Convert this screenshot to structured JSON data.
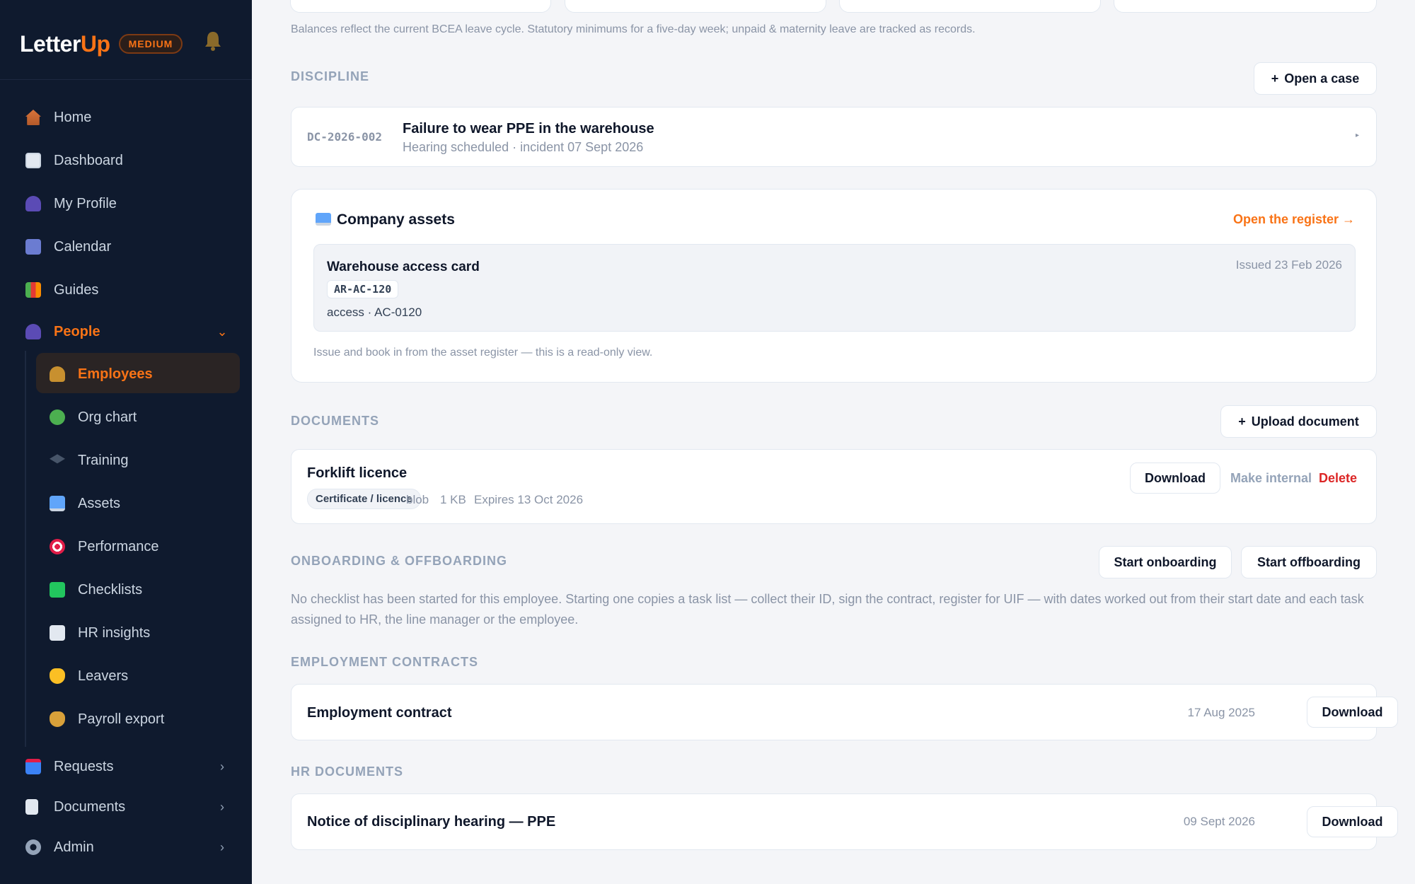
{
  "brand": {
    "name_part1": "Letter",
    "name_part2": "Up",
    "badge": "MEDIUM"
  },
  "nav": {
    "home": "Home",
    "dashboard": "Dashboard",
    "profile": "My Profile",
    "calendar": "Calendar",
    "guides": "Guides",
    "people": "People",
    "requests": "Requests",
    "documents": "Documents",
    "admin": "Admin"
  },
  "people_sub": {
    "employees": "Employees",
    "org_chart": "Org chart",
    "training": "Training",
    "assets": "Assets",
    "performance": "Performance",
    "checklists": "Checklists",
    "hr_insights": "HR insights",
    "leavers": "Leavers",
    "payroll_export": "Payroll export"
  },
  "leave_note": "Balances reflect the current BCEA leave cycle. Statutory minimums for a five-day week; unpaid & maternity leave are tracked as records.",
  "discipline": {
    "title": "DISCIPLINE",
    "open_case": "Open a case",
    "case_id": "DC-2026-002",
    "case_title": "Failure to wear PPE in the warehouse",
    "case_sub": "Hearing scheduled · incident 07 Sept 2026"
  },
  "assets": {
    "title": "Company assets",
    "open_register": "Open the register →",
    "item_name": "Warehouse access card",
    "item_tag": "AR-AC-120",
    "item_meta": "access · AC-0120",
    "item_issued": "Issued 23 Feb 2026",
    "note": "Issue and book in from the asset register — this is a read-only view."
  },
  "documents": {
    "title": "DOCUMENTS",
    "upload": "Upload document",
    "doc_name": "Forklift licence",
    "doc_type": "Certificate / licence",
    "doc_storage": "blob",
    "doc_size": "1 KB",
    "doc_expiry": "Expires 13 Oct 2026",
    "download": "Download",
    "make_internal": "Make internal",
    "delete": "Delete"
  },
  "onboarding": {
    "title": "ONBOARDING & OFFBOARDING",
    "start_onboarding": "Start onboarding",
    "start_offboarding": "Start offboarding",
    "description": "No checklist has been started for this employee. Starting one copies a task list — collect their ID, sign the contract, register for UIF — with dates worked out from their start date and each task assigned to HR, the line manager or the employee."
  },
  "contracts": {
    "title": "EMPLOYMENT CONTRACTS",
    "name": "Employment contract",
    "date": "17 Aug 2025",
    "download": "Download"
  },
  "hr_docs": {
    "title": "HR DOCUMENTS",
    "name": "Notice of disciplinary hearing — PPE",
    "date": "09 Sept 2026",
    "download": "Download"
  },
  "colors": {
    "accent": "#f97316",
    "sidebar": "#0f1a2e",
    "danger": "#dc2626"
  }
}
